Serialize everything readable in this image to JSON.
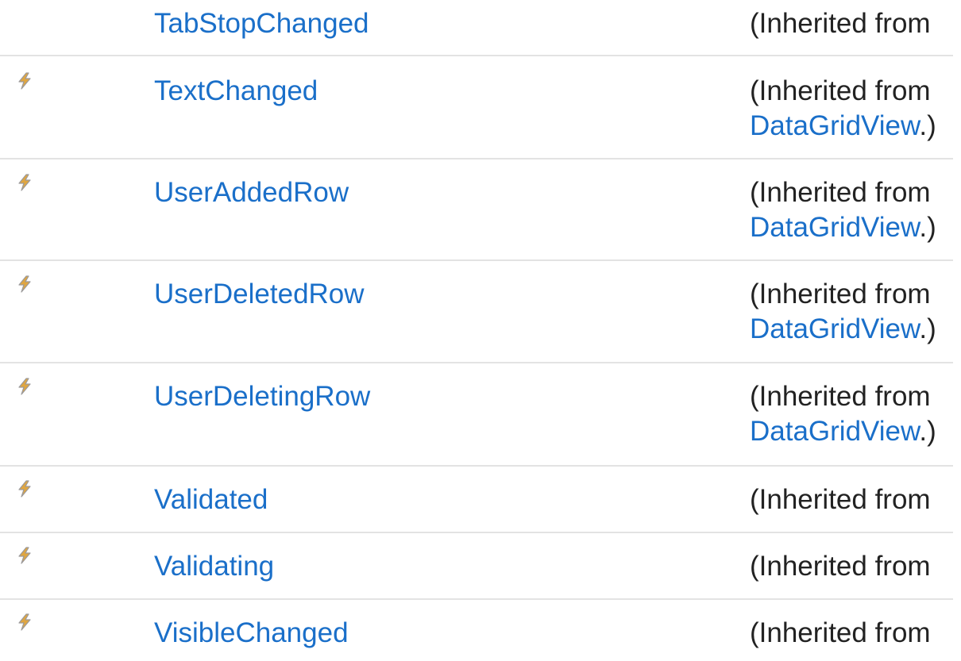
{
  "rows": [
    {
      "name": "TabStopChanged",
      "has_icon": false,
      "inherited_label": "(Inherited from",
      "inherited_link": "",
      "inherited_suffix": ""
    },
    {
      "name": "TextChanged",
      "has_icon": true,
      "inherited_label": "(Inherited from",
      "inherited_link": "DataGridView",
      "inherited_suffix": ".)"
    },
    {
      "name": "UserAddedRow",
      "has_icon": true,
      "inherited_label": "(Inherited from",
      "inherited_link": "DataGridView",
      "inherited_suffix": ".)"
    },
    {
      "name": "UserDeletedRow",
      "has_icon": true,
      "inherited_label": "(Inherited from",
      "inherited_link": "DataGridView",
      "inherited_suffix": ".)"
    },
    {
      "name": "UserDeletingRow",
      "has_icon": true,
      "inherited_label": "(Inherited from",
      "inherited_link": "DataGridView",
      "inherited_suffix": ".)"
    },
    {
      "name": "Validated",
      "has_icon": true,
      "inherited_label": "(Inherited from",
      "inherited_link": "",
      "inherited_suffix": ""
    },
    {
      "name": "Validating",
      "has_icon": true,
      "inherited_label": "(Inherited from",
      "inherited_link": "",
      "inherited_suffix": ""
    },
    {
      "name": "VisibleChanged",
      "has_icon": true,
      "inherited_label": "(Inherited from",
      "inherited_link": "",
      "inherited_suffix": ""
    }
  ],
  "icon_name": "event-lightning-icon",
  "colors": {
    "link": "#1a6fc9",
    "text": "#222222",
    "divider": "#e3e3e3"
  }
}
